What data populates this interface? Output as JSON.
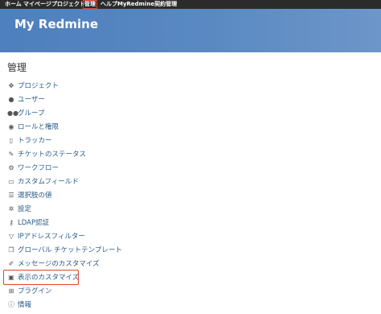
{
  "topnav": {
    "items": [
      "ホーム",
      "マイページ",
      "プロジェクト",
      "管理",
      "ヘルプ",
      "MyRedmine契約管理"
    ],
    "selected": "管理"
  },
  "header": {
    "title": "My Redmine"
  },
  "page": {
    "title": "管理"
  },
  "admin_menu": [
    {
      "label": "プロジェクト",
      "icon": "projects-icon"
    },
    {
      "label": "ユーザー",
      "icon": "user-icon"
    },
    {
      "label": "グループ",
      "icon": "group-icon"
    },
    {
      "label": "ロールと権限",
      "icon": "eye-icon"
    },
    {
      "label": "トラッカー",
      "icon": "tracker-icon"
    },
    {
      "label": "チケットのステータス",
      "icon": "edit-icon"
    },
    {
      "label": "ワークフロー",
      "icon": "workflow-icon"
    },
    {
      "label": "カスタムフィールド",
      "icon": "custom-field-icon"
    },
    {
      "label": "選択肢の値",
      "icon": "list-icon"
    },
    {
      "label": "設定",
      "icon": "gear-icon"
    },
    {
      "label": "LDAP認証",
      "icon": "key-icon"
    },
    {
      "label": "IPアドレスフィルター",
      "icon": "filter-icon"
    },
    {
      "label": "グローバル チケットテンプレート",
      "icon": "template-icon"
    },
    {
      "label": "メッセージのカスタマイズ",
      "icon": "pencil-icon"
    },
    {
      "label": "表示のカスタマイズ",
      "icon": "display-icon"
    },
    {
      "label": "プラグイン",
      "icon": "plugin-icon"
    },
    {
      "label": "情報",
      "icon": "info-icon"
    }
  ],
  "highlighted_item": "表示のカスタマイズ"
}
